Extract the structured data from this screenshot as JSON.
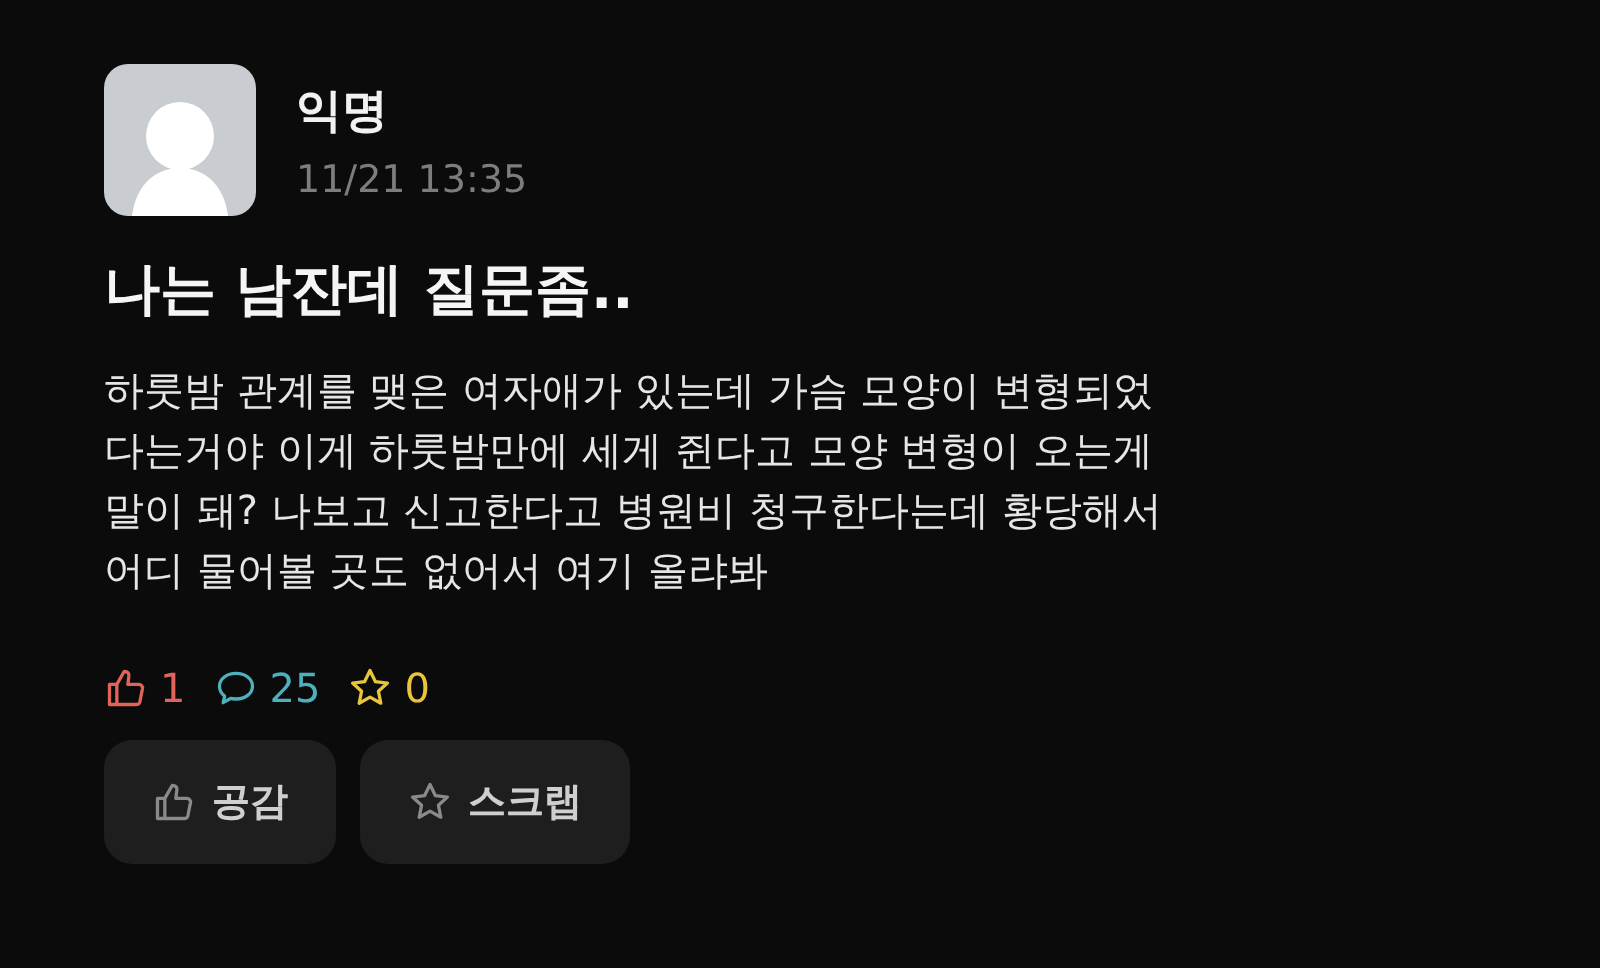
{
  "author": {
    "name": "익명",
    "time": "11/21 13:35"
  },
  "post": {
    "title": "나는 남잔데 질문좀..",
    "body": "하룻밤 관계를 맺은 여자애가 있는데 가슴 모양이 변형되었\n다는거야 이게 하룻밤만에 세게 쥔다고 모양 변형이 오는게\n말이 돼? 나보고 신고한다고 병원비 청구한다는데 황당해서\n어디 물어볼 곳도 없어서 여기 올랴봐"
  },
  "stats": [
    {
      "kind": "like",
      "value": "1",
      "color": "#e0645a"
    },
    {
      "kind": "comment",
      "value": "25",
      "color": "#4fb0bd"
    },
    {
      "kind": "scrap",
      "value": "0",
      "color": "#e8c53a"
    }
  ],
  "buttons": [
    {
      "kind": "like",
      "label": "공감"
    },
    {
      "kind": "scrap",
      "label": "스크랩"
    }
  ]
}
